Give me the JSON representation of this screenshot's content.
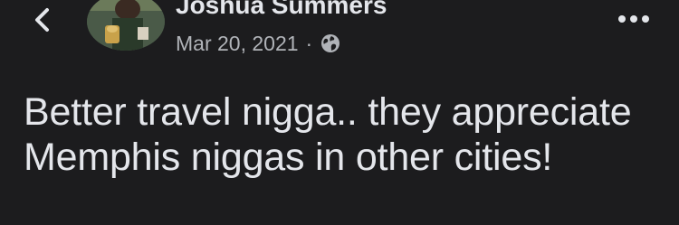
{
  "header": {
    "back_icon": "chevron-left-icon",
    "author_name": "Joshua Summers",
    "date": "Mar 20, 2021",
    "separator": "·",
    "privacy_icon": "globe-icon",
    "more_icon": "more-horizontal-icon"
  },
  "post": {
    "text": "Better travel nigga.. they appreciate Memphis niggas in other cities!"
  },
  "colors": {
    "background": "#1c1c1e",
    "primary_text": "#e4e6eb",
    "secondary_text": "#b0b3b8"
  }
}
